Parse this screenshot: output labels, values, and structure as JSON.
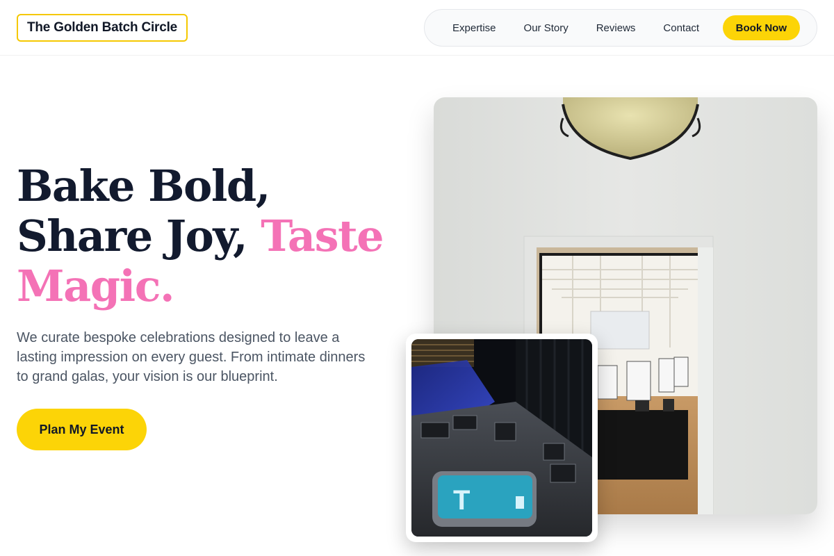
{
  "header": {
    "logo": "The Golden Batch Circle",
    "nav": {
      "links": [
        "Expertise",
        "Our Story",
        "Reviews",
        "Contact"
      ],
      "cta": "Book Now"
    }
  },
  "hero": {
    "headline": {
      "line1": "Bake Bold,",
      "line2_start": "Share Joy,",
      "line2_highlight": "Taste",
      "line3_highlight": "Magic."
    },
    "subtext": "We curate bespoke celebrations designed to leave a lasting impression on every guest. From intimate dinners to grand galas, your vision is our blueprint.",
    "cta": "Plan My Event"
  },
  "images": {
    "main": "event hall interior viewed through doorway, ceiling lamp",
    "secondary": "event venue setup with blue stage lights"
  },
  "colors": {
    "accent": "#fcd407",
    "highlight": "#f472b6",
    "heading": "#121a2e",
    "body_text": "#4b5563"
  }
}
